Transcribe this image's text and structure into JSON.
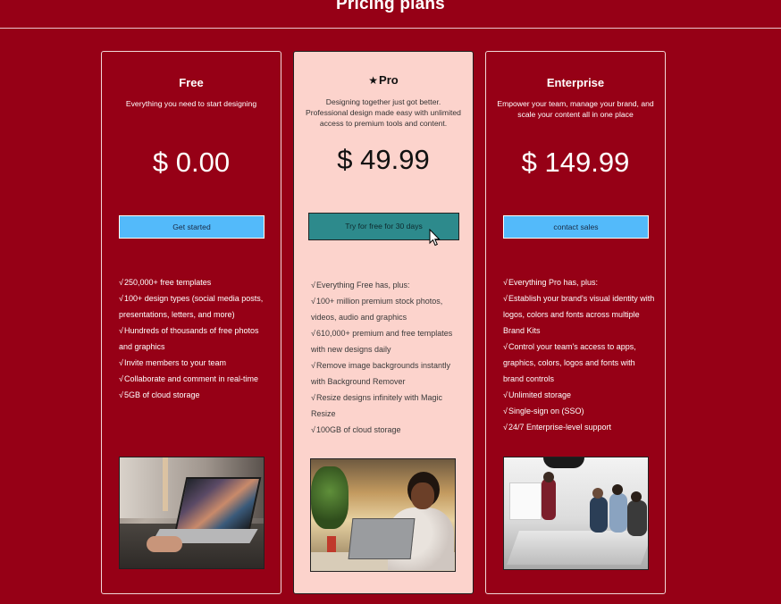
{
  "page": {
    "title": "Pricing plans"
  },
  "plans": {
    "free": {
      "name": "Free",
      "description": "Everything you need to start designing",
      "price": "$ 0.00",
      "cta": "Get started",
      "features": [
        "250,000+ free templates",
        "100+ design types (social media posts, presentations, letters, and more)",
        "Hundreds of thousands of free photos and graphics",
        "Invite members to your team",
        "Collaborate and comment in real-time",
        "5GB of cloud storage"
      ],
      "check": "√"
    },
    "pro": {
      "icon": "star-icon",
      "name": "Pro",
      "description": "Designing together just got better. Professional design made easy with unlimited access to premium tools and content.",
      "price": "$ 49.99",
      "cta": "Try for free for 30 days",
      "features": [
        "Everything Free has, plus:",
        "100+ million premium stock photos, videos, audio and graphics",
        "610,000+ premium and free templates with new designs daily",
        "Remove image backgrounds instantly with Background Remover",
        "Resize designs infinitely with Magic Resize",
        "100GB of cloud storage"
      ],
      "check": "√"
    },
    "enterprise": {
      "name": "Enterprise",
      "description": "Empower your team, manage your brand, and scale your content all in one place",
      "price": "$ 149.99",
      "cta": "contact sales",
      "features": [
        "Everything Pro has, plus:",
        "Establish your brand's visual identity with logos, colors and fonts across multiple Brand Kits",
        "Control your team's access to apps, graphics, colors, logos and fonts with brand controls",
        "Unlimited storage",
        "Single-sign on (SSO)",
        "24/7 Enterprise-level support"
      ],
      "check": "√"
    }
  },
  "colors": {
    "background": "#960016",
    "pro_card": "#fcd3cc",
    "cta_blue": "#53bafa",
    "cta_teal": "#2d8a8c"
  }
}
